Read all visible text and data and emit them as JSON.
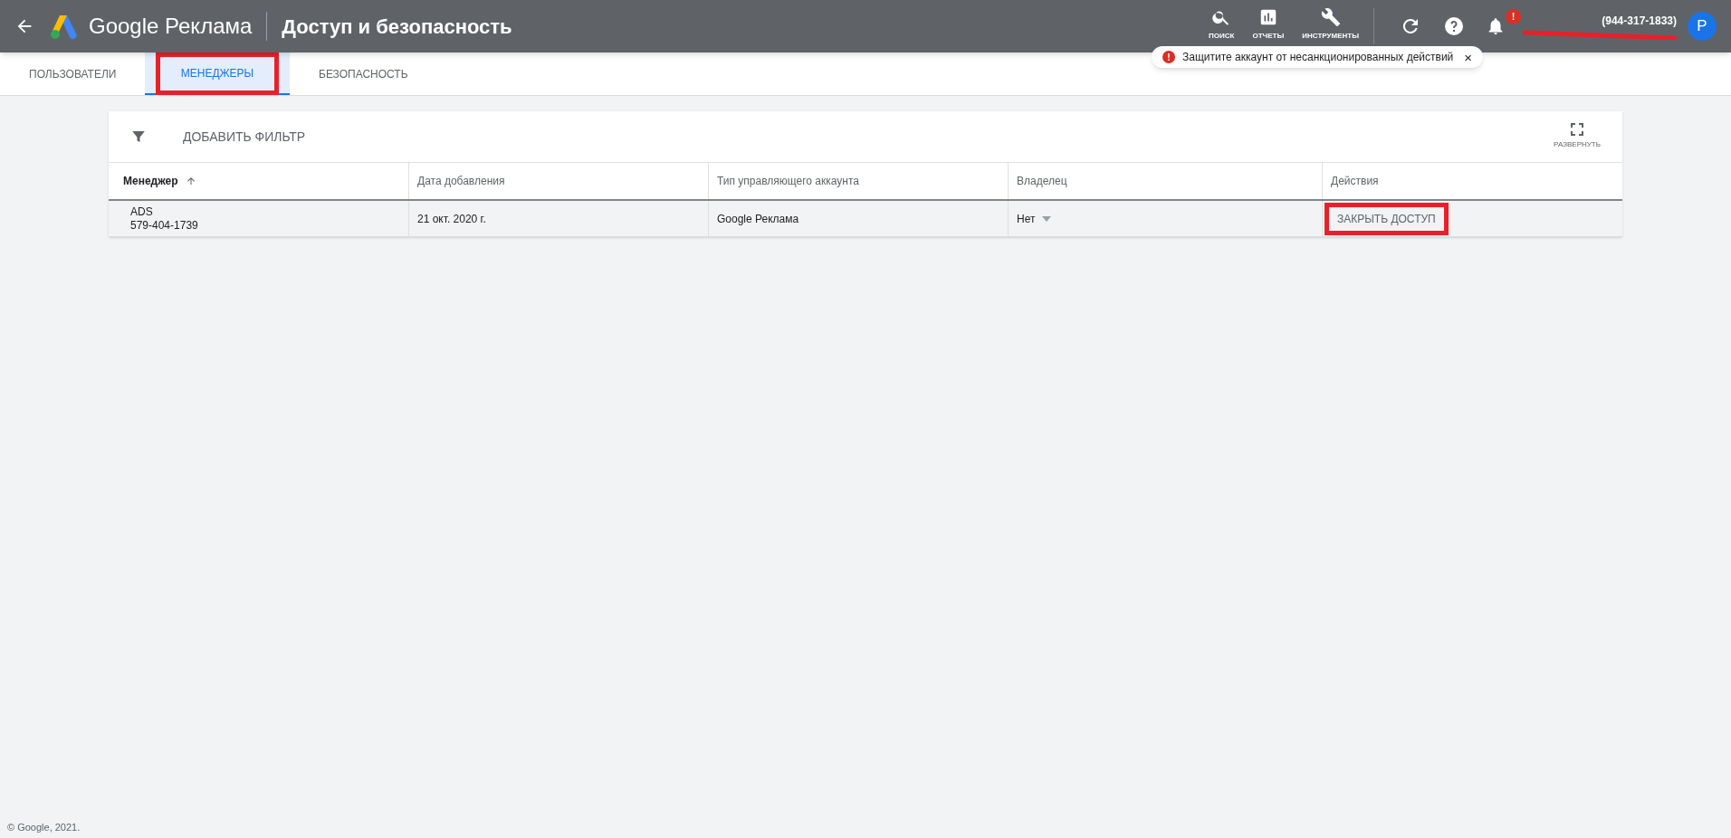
{
  "header": {
    "product": "Google Реклама",
    "title": "Доступ и безопасность",
    "tools": [
      {
        "kind": "search",
        "label": "ПОИСК"
      },
      {
        "kind": "reports",
        "label": "ОТЧЕТЫ"
      },
      {
        "kind": "tools",
        "label": "ИНСТРУМЕНТЫ"
      }
    ],
    "phone": "(944-317-1833)",
    "avatar": "P",
    "alert": "!",
    "email_redacted": true
  },
  "notice": {
    "icon": "!",
    "text": "Защитите аккаунт от несанкционированных действий",
    "close": "×"
  },
  "tabs": [
    {
      "label": "ПОЛЬЗОВАТЕЛИ",
      "selected": false,
      "highlight": false
    },
    {
      "label": "МЕНЕДЖЕРЫ",
      "selected": true,
      "highlight": true
    },
    {
      "label": "БЕЗОПАСНОСТЬ",
      "selected": false,
      "highlight": false
    }
  ],
  "toolbar": {
    "filter": "ДОБАВИТЬ ФИЛЬТР",
    "expand": "РАЗВЕРНУТЬ"
  },
  "table": {
    "columns": [
      {
        "label": "Менеджер",
        "sorted": true
      },
      {
        "label": "Дата добавления",
        "sorted": false
      },
      {
        "label": "Тип управляющего аккаунта",
        "sorted": false
      },
      {
        "label": "Владелец",
        "sorted": false
      },
      {
        "label": "Действия",
        "sorted": false
      }
    ],
    "rows": [
      {
        "name": "ADS",
        "id": "579-404-1739",
        "date": "21 окт. 2020 г.",
        "type": "Google Реклама",
        "owner": "Нет",
        "action": "ЗАКРЫТЬ ДОСТУП",
        "action_highlight": true
      }
    ]
  },
  "footer": "© Google, 2021."
}
